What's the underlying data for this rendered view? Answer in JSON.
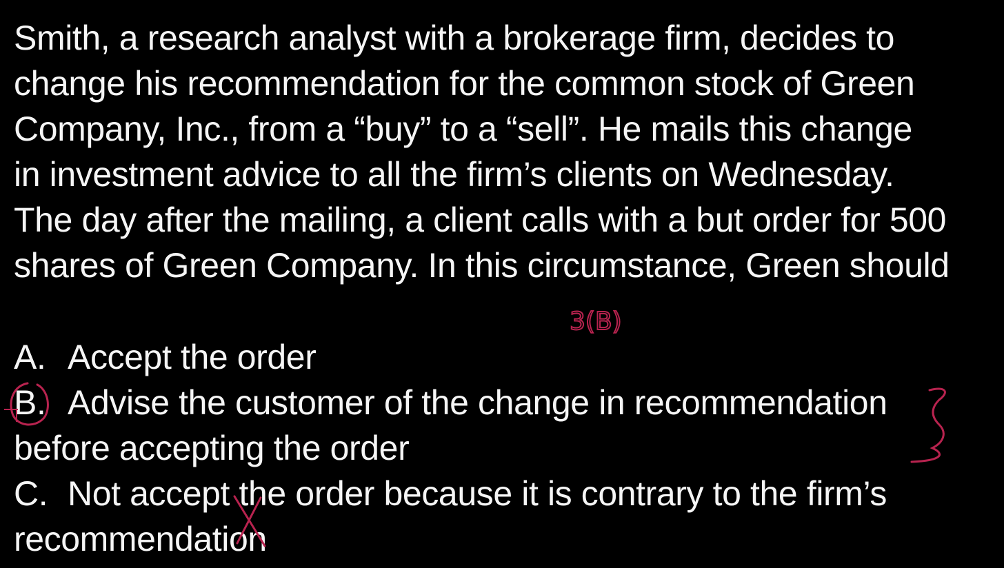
{
  "question": {
    "text": "Smith, a research analyst with a brokerage firm, decides to\nchange his recommendation for the common stock of Green\nCompany, Inc., from a “buy” to a “sell”.  He mails this change\nin investment advice to all the firm’s clients on Wednesday.\nThe day after the mailing, a client calls with a but order for 500\nshares of Green Company.  In this circumstance, Green should"
  },
  "options": [
    {
      "letter": "A.",
      "text": "Accept the order"
    },
    {
      "letter": "B.",
      "text": "Advise the customer of the change in recommendation\nbefore accepting the order"
    },
    {
      "letter": "C.",
      "text": "Not accept the order because it is contrary to the firm’s\nrecommendation"
    }
  ],
  "annotations": {
    "rule_reference": "3(B)",
    "ink_color": "#b8234f"
  }
}
